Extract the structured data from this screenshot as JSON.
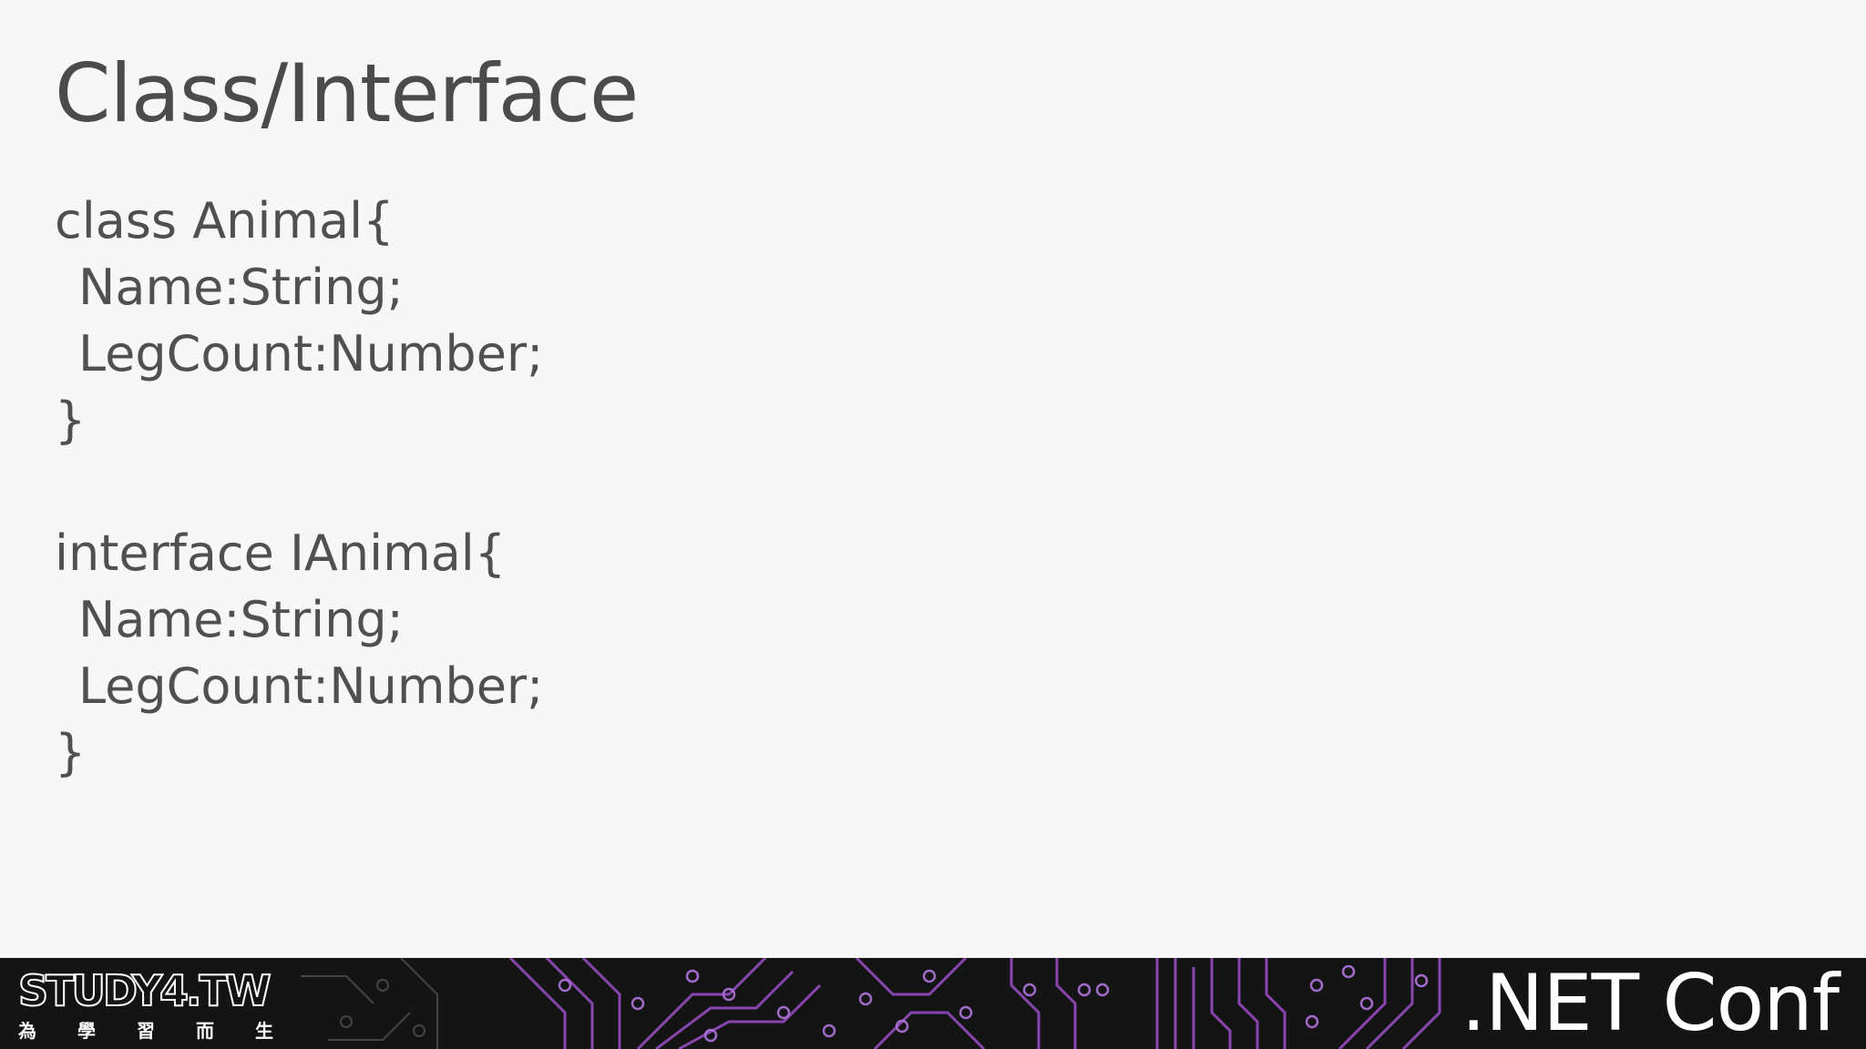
{
  "slide": {
    "title": "Class/Interface",
    "class_block": {
      "lines": [
        "class Animal{",
        "Name:String;",
        "LegCount:Number;",
        "}"
      ]
    },
    "interface_block": {
      "lines": [
        "interface IAnimal{",
        "Name:String;",
        "LegCount:Number;",
        "}"
      ]
    }
  },
  "footer": {
    "logo": {
      "main": "STUDY4.TW",
      "sub": [
        "為",
        "學",
        "習",
        "而",
        "生"
      ]
    },
    "brand": ".NET Conf"
  },
  "colors": {
    "background": "#f7f7f7",
    "text": "#4b4b4b",
    "footer_bg": "#141414",
    "circuit_accent": "#9b4fc8",
    "footer_text": "#ffffff"
  }
}
